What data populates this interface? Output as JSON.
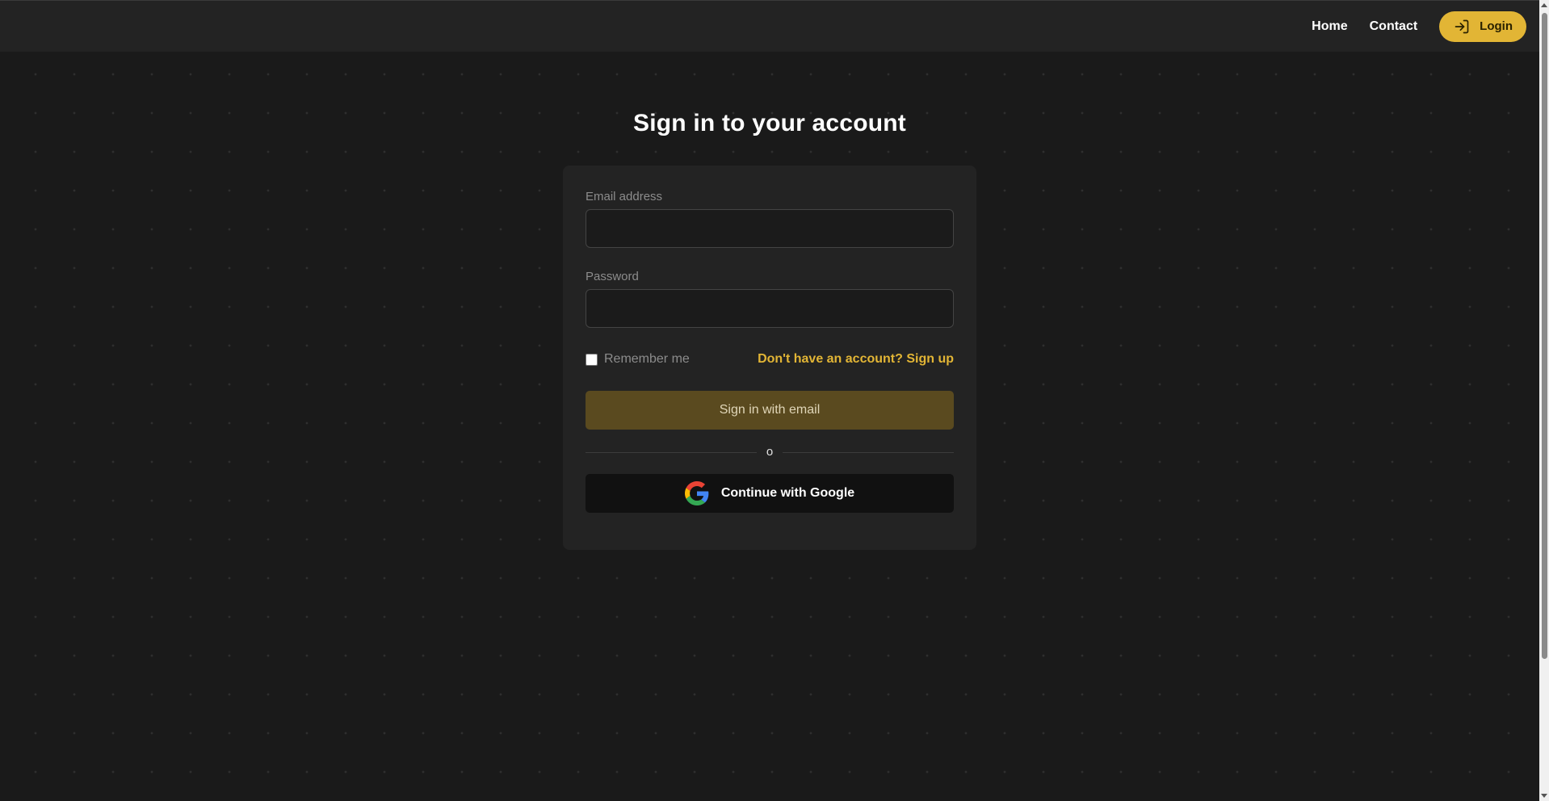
{
  "nav": {
    "home_label": "Home",
    "contact_label": "Contact",
    "login_label": "Login",
    "login_icon": "login-arrow-icon"
  },
  "main": {
    "title": "Sign in to your account"
  },
  "form": {
    "email_label": "Email address",
    "email_value": "",
    "password_label": "Password",
    "password_value": "",
    "remember_label": "Remember me",
    "remember_checked": false,
    "signup_link": "Don't have an account? Sign up",
    "email_button": "Sign in with email",
    "divider_text": "o",
    "google_button": "Continue with Google",
    "google_icon": "google-icon"
  },
  "colors": {
    "accent": "#e2b535",
    "background": "#1a1a1a",
    "card": "#232323",
    "email_button_bg": "#5a4a1f",
    "google_button_bg": "#111111"
  }
}
